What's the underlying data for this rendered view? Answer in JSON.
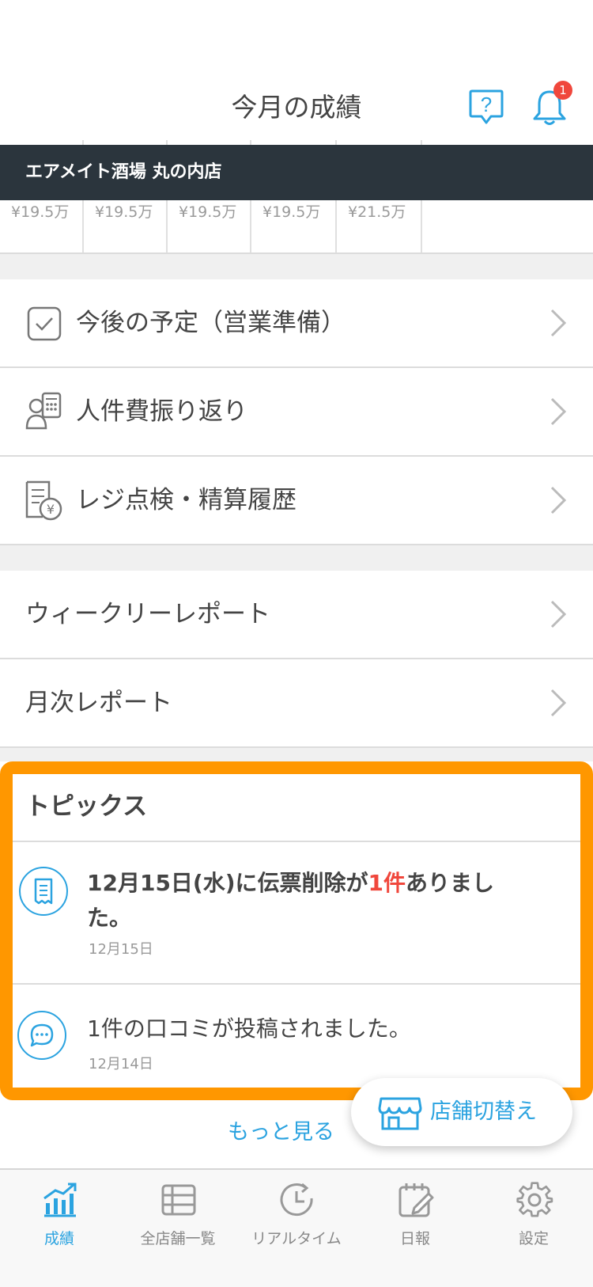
{
  "header": {
    "title": "今月の成績",
    "notification_count": "1"
  },
  "store": {
    "name": "エアメイト酒場 丸の内店"
  },
  "sales_values": [
    "¥19.5万",
    "¥19.5万",
    "¥19.5万",
    "¥19.5万",
    "¥21.5万"
  ],
  "menu_group1": [
    {
      "label": "今後の予定（営業準備）",
      "icon": "checkbox-icon"
    },
    {
      "label": "人件費振り返り",
      "icon": "staff-calculator-icon"
    },
    {
      "label": "レジ点検・精算履歴",
      "icon": "receipt-yen-icon"
    }
  ],
  "menu_group2": [
    {
      "label": "ウィークリーレポート"
    },
    {
      "label": "月次レポート"
    }
  ],
  "topics": {
    "title": "トピックス",
    "items": [
      {
        "text_before": "12月15日(水)に伝票削除が",
        "highlight": "1件",
        "text_after": "ありました。",
        "date": "12月15日",
        "icon": "receipt-icon"
      },
      {
        "text": "1件の口コミが投稿されました。",
        "date": "12月14日",
        "icon": "chat-bubble-icon"
      }
    ],
    "more_label": "もっと見る"
  },
  "store_switch": {
    "label": "店舗切替え",
    "icon": "store-icon"
  },
  "tabs": [
    {
      "label": "成績",
      "icon": "chart-icon",
      "active": true
    },
    {
      "label": "全店舗一覧",
      "icon": "list-icon",
      "active": false
    },
    {
      "label": "リアルタイム",
      "icon": "clock-icon",
      "active": false
    },
    {
      "label": "日報",
      "icon": "notepad-icon",
      "active": false
    },
    {
      "label": "設定",
      "icon": "gear-icon",
      "active": false
    }
  ],
  "colors": {
    "accent": "#2ba3e0",
    "highlight": "#ff9700",
    "alert": "#f0473c",
    "banner": "#2b353d"
  }
}
